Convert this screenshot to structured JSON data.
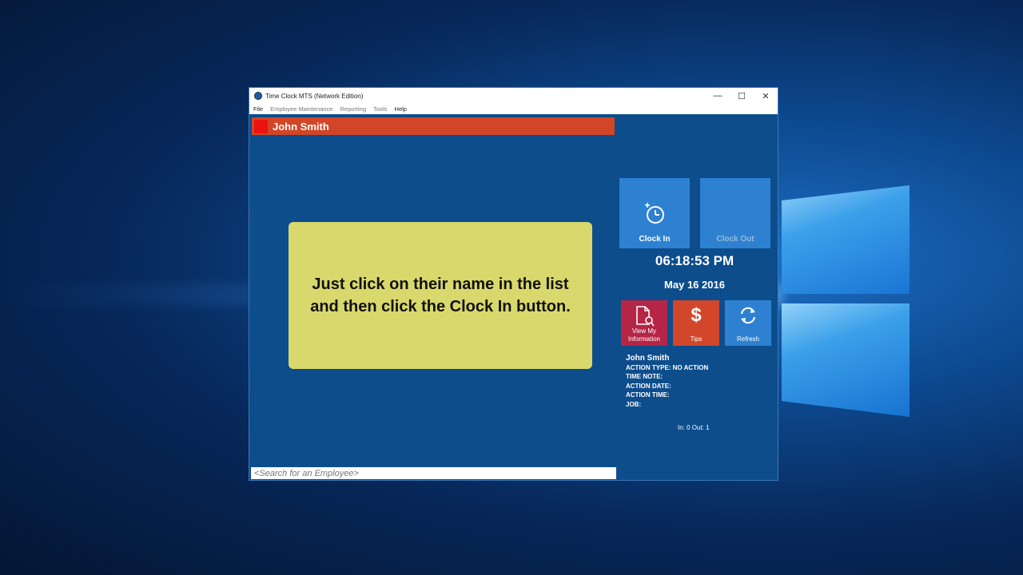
{
  "window": {
    "title": "Time Clock MTS (Network Edition)",
    "controls": {
      "minimize": "—",
      "maximize": "☐",
      "close": "✕"
    }
  },
  "menu": [
    "File",
    "Employee Maintenance",
    "Reporting",
    "Tools",
    "Help"
  ],
  "selected_employee": {
    "name": "John Smith",
    "swatch_color": "#ee1111",
    "bar_color": "#d24526"
  },
  "hint": {
    "text": "Just click on their name in the list and then click the Clock In button."
  },
  "search": {
    "placeholder": "<Search for an Employee>"
  },
  "buttons": {
    "clock_in": "Clock In",
    "clock_out": "Clock Out",
    "view_info": "View My Information",
    "tips": "Tips",
    "tips_symbol": "$",
    "refresh": "Refresh"
  },
  "clock": {
    "time": "06:18:53 PM",
    "date": "May 16 2016"
  },
  "status": {
    "employee": "John Smith",
    "action_type": "ACTION TYPE: NO ACTION",
    "time_note": "TIME NOTE:",
    "action_date": "ACTION DATE:",
    "action_time": "ACTION TIME:",
    "job": "JOB:"
  },
  "counts": "In: 0 Out: 1",
  "colors": {
    "window_bg": "#0d4d8c",
    "tile_blue": "#2e81d0",
    "tile_red": "#b52546",
    "tile_orange": "#d2462a",
    "hint_bg": "#d9d86c"
  }
}
